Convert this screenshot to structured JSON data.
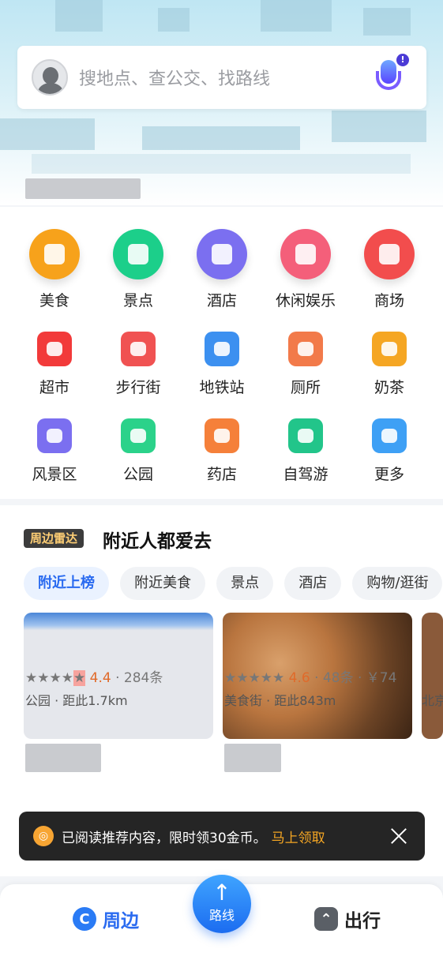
{
  "search": {
    "placeholder": "搜地点、查公交、找路线"
  },
  "categories_row1": [
    {
      "label": "美食",
      "icon": "food-icon",
      "color": "#f7a21b"
    },
    {
      "label": "景点",
      "icon": "scenic-icon",
      "color": "#1ccf8a"
    },
    {
      "label": "酒店",
      "icon": "hotel-icon",
      "color": "#7b6ff0"
    },
    {
      "label": "休闲娱乐",
      "icon": "game-icon",
      "color": "#f45f7a"
    },
    {
      "label": "商场",
      "icon": "mall-icon",
      "color": "#f24d4d"
    }
  ],
  "categories_row2": [
    {
      "label": "超市",
      "icon": "cart-icon",
      "color": "#f23a3a"
    },
    {
      "label": "步行街",
      "icon": "shopping-bag-icon",
      "color": "#f05252"
    },
    {
      "label": "地铁站",
      "icon": "subway-icon",
      "color": "#3c90f0"
    },
    {
      "label": "厕所",
      "icon": "toilet-icon",
      "color": "#f27a4a"
    },
    {
      "label": "奶茶",
      "icon": "milk-tea-icon",
      "color": "#f5a623"
    }
  ],
  "categories_row3": [
    {
      "label": "风景区",
      "icon": "scenic-area-icon",
      "color": "#7b6ff0"
    },
    {
      "label": "公园",
      "icon": "park-icon",
      "color": "#2bd28a"
    },
    {
      "label": "药店",
      "icon": "pharmacy-icon",
      "color": "#f5803a"
    },
    {
      "label": "自驾游",
      "icon": "car-icon",
      "color": "#22c58a"
    },
    {
      "label": "更多",
      "icon": "more-grid-icon",
      "color": "#3ea0f5"
    }
  ],
  "nearby": {
    "badge": "周边雷达",
    "title": "附近人都爱去",
    "chips": [
      "附近上榜",
      "附近美食",
      "景点",
      "酒店",
      "购物/逛街"
    ],
    "pois": [
      {
        "rating": "4.4",
        "reviews": "· 284条",
        "meta": "公园 · 距此1.7km"
      },
      {
        "rating": "4.6",
        "reviews": "· 48条 · ￥74",
        "meta": "美食街 · 距此843m"
      }
    ],
    "third_meta": "北京"
  },
  "toast": {
    "text": "已阅读推荐内容，限时领30金币。",
    "action": "马上领取"
  },
  "bottom_nav": {
    "left": "周边",
    "center": "路线",
    "right": "出行"
  }
}
